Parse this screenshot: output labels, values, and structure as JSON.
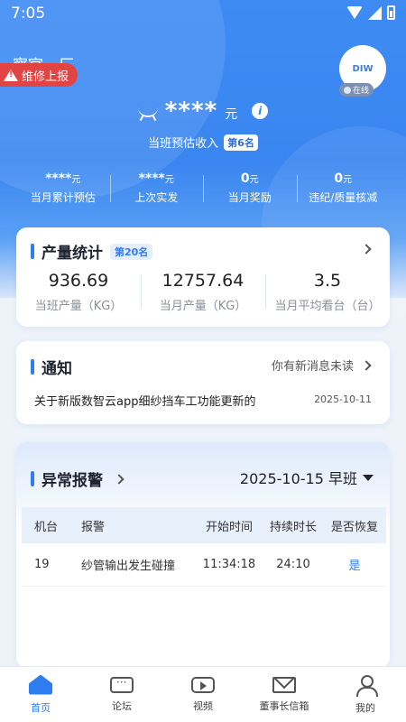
{
  "status_bar": {
    "time": "7:05"
  },
  "header": {
    "team_name": "察官一厂",
    "repair_badge": "维修上报",
    "avatar_text": "DIW",
    "online_badge": "在线",
    "income_value": "****",
    "income_unit": "元",
    "income_label": "当班预估收入",
    "income_rank": "第6名",
    "stats": [
      {
        "value": "****",
        "unit": "元",
        "label": "当月累计预估"
      },
      {
        "value": "****",
        "unit": "元",
        "label": "上次实发"
      },
      {
        "value": "0",
        "unit": "元",
        "label": "当月奖励"
      },
      {
        "value": "0",
        "unit": "元",
        "label": "违纪/质量核减"
      }
    ]
  },
  "production": {
    "title": "产量统计",
    "rank": "第20名",
    "items": [
      {
        "value": "936.69",
        "label": "当班产量（KG）"
      },
      {
        "value": "12757.64",
        "label": "当月产量（KG）"
      },
      {
        "value": "3.5",
        "label": "当月平均看台（台）"
      }
    ]
  },
  "notice": {
    "title": "通知",
    "unread_text": "你有新消息未读",
    "message": "关于新版数智云app细纱挡车工功能更新的",
    "date": "2025-10-11"
  },
  "alarm": {
    "title": "异常报警",
    "shift": "2025-10-15 早班",
    "columns": [
      "机台",
      "报警",
      "开始时间",
      "持续时长",
      "是否恢复"
    ],
    "rows": [
      {
        "machine": "19",
        "alarm": "纱管输出发生碰撞",
        "start": "11:34:18",
        "duration": "24:10",
        "recovered": "是"
      }
    ]
  },
  "tabbar": {
    "tabs": [
      {
        "label": "首页",
        "icon": "home-icon"
      },
      {
        "label": "论坛",
        "icon": "chat-icon"
      },
      {
        "label": "视频",
        "icon": "video-icon"
      },
      {
        "label": "董事长信箱",
        "icon": "mail-icon"
      },
      {
        "label": "我的",
        "icon": "user-icon"
      }
    ]
  },
  "colors": {
    "primary": "#2f7bf0",
    "hero": "#3a86f0",
    "danger": "#e24444"
  }
}
